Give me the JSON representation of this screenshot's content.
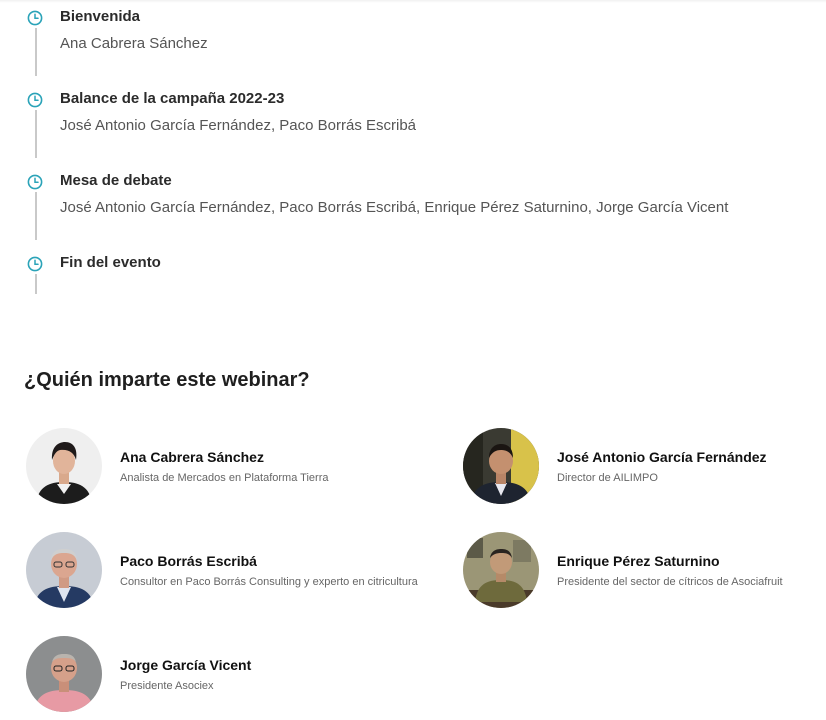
{
  "agenda": [
    {
      "title": "Bienvenida",
      "speakers": "Ana Cabrera Sánchez"
    },
    {
      "title": "Balance de la campaña 2022-23",
      "speakers": "José Antonio García Fernández, Paco Borrás Escribá"
    },
    {
      "title": "Mesa de debate",
      "speakers": "José Antonio García Fernández, Paco Borrás Escribá, Enrique Pérez Saturnino, Jorge García Vicent"
    },
    {
      "title": "Fin del evento",
      "speakers": ""
    }
  ],
  "speakers_section": {
    "title": "¿Quién imparte este webinar?",
    "speakers": [
      {
        "name": "Ana Cabrera Sánchez",
        "role": "Analista de Mercados en Plataforma Tierra"
      },
      {
        "name": "José Antonio García Fernández",
        "role": "Director de AILIMPO"
      },
      {
        "name": "Paco Borrás Escribá",
        "role": "Consultor en Paco Borrás Consulting y experto en citricultura"
      },
      {
        "name": "Enrique Pérez Saturnino",
        "role": "Presidente del sector de cítricos de Asociafruit"
      },
      {
        "name": "Jorge García Vicent",
        "role": "Presidente Asociex"
      }
    ]
  },
  "colors": {
    "accent": "#2aa3b8",
    "timeline_line": "#c9c9c9"
  },
  "icons": {
    "agenda_item": "clock-icon"
  }
}
